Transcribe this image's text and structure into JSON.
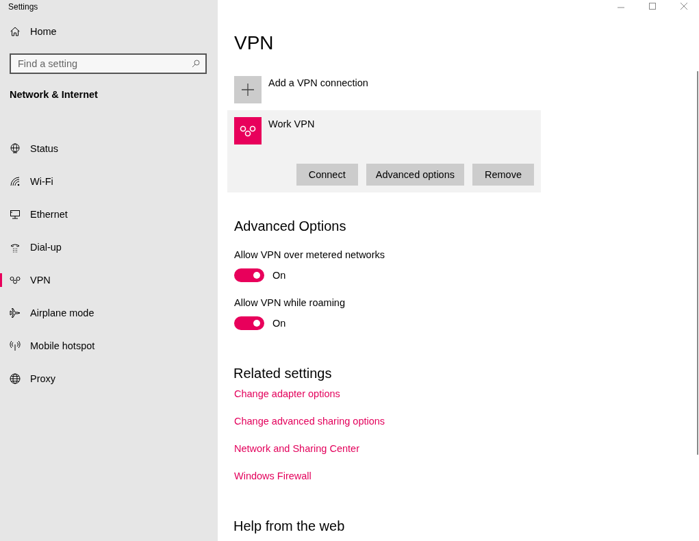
{
  "window": {
    "title": "Settings"
  },
  "sidebar": {
    "home": "Home",
    "search": {
      "placeholder": "Find a setting"
    },
    "section": "Network & Internet",
    "items": [
      {
        "label": "Status",
        "selected": false
      },
      {
        "label": "Wi-Fi",
        "selected": false
      },
      {
        "label": "Ethernet",
        "selected": false
      },
      {
        "label": "Dial-up",
        "selected": false
      },
      {
        "label": "VPN",
        "selected": true
      },
      {
        "label": "Airplane mode",
        "selected": false
      },
      {
        "label": "Mobile hotspot",
        "selected": false
      },
      {
        "label": "Proxy",
        "selected": false
      }
    ]
  },
  "page": {
    "title": "VPN",
    "add_label": "Add a VPN connection",
    "connection": {
      "name": "Work VPN",
      "buttons": [
        "Connect",
        "Advanced options",
        "Remove"
      ]
    },
    "advanced_heading": "Advanced Options",
    "toggles": [
      {
        "label": "Allow VPN over metered networks",
        "on": true,
        "state_text": "On"
      },
      {
        "label": "Allow VPN while roaming",
        "on": true,
        "state_text": "On"
      }
    ],
    "related_heading": "Related settings",
    "links": [
      "Change adapter options",
      "Change advanced sharing options",
      "Network and Sharing Center",
      "Windows Firewall"
    ],
    "help_heading": "Help from the web"
  }
}
